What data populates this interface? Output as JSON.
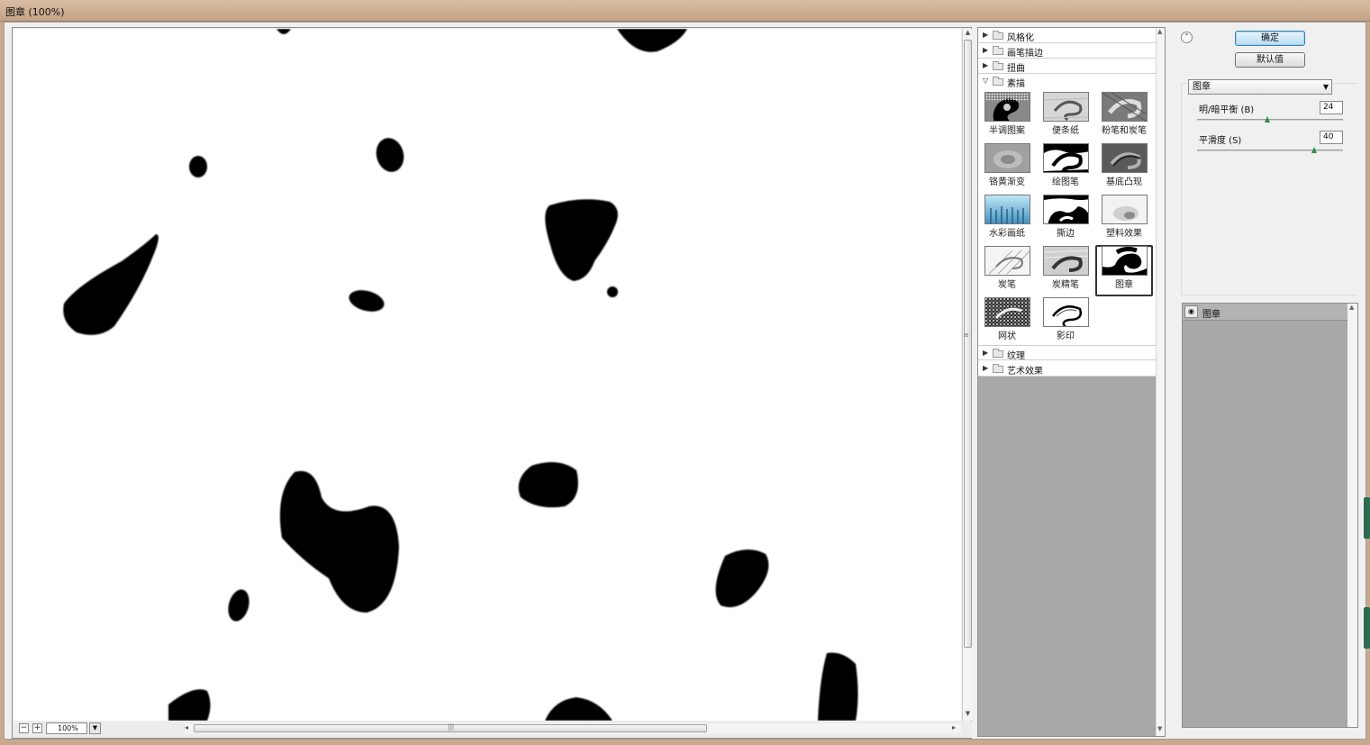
{
  "window": {
    "title": "图章 (100%)"
  },
  "preview": {
    "zoom": "100%",
    "zoom_out_icon": "minus-icon",
    "zoom_in_icon": "plus-icon"
  },
  "gallery": {
    "categories_top": [
      {
        "label": "风格化",
        "expanded": false
      },
      {
        "label": "画笔描边",
        "expanded": false
      },
      {
        "label": "扭曲",
        "expanded": false
      },
      {
        "label": "素描",
        "expanded": true
      }
    ],
    "filters": [
      {
        "label": "半调图案"
      },
      {
        "label": "便条纸"
      },
      {
        "label": "粉笔和炭笔"
      },
      {
        "label": "铬黄渐变"
      },
      {
        "label": "绘图笔"
      },
      {
        "label": "基底凸现"
      },
      {
        "label": "水彩画纸"
      },
      {
        "label": "撕边"
      },
      {
        "label": "塑料效果"
      },
      {
        "label": "炭笔"
      },
      {
        "label": "炭精笔"
      },
      {
        "label": "图章",
        "selected": true
      },
      {
        "label": "网状"
      },
      {
        "label": "影印"
      }
    ],
    "categories_bottom": [
      {
        "label": "纹理",
        "expanded": false
      },
      {
        "label": "艺术效果",
        "expanded": false
      }
    ]
  },
  "settings": {
    "ok_label": "确定",
    "default_label": "默认值",
    "filter_select": "图章",
    "params": [
      {
        "label": "明/暗平衡 (B)",
        "value": "24",
        "fraction": 0.48
      },
      {
        "label": "平滑度 (S)",
        "value": "40",
        "fraction": 0.8
      }
    ]
  },
  "layers": [
    {
      "name": "图章",
      "visible": true
    }
  ],
  "colors": {
    "title_bar": "#c9a98e",
    "panel_bg": "#f0f0f0",
    "list_bg": "#a8a8a8",
    "accent_button": "#b9dcf3",
    "slider_knob": "#2c8b4c"
  }
}
